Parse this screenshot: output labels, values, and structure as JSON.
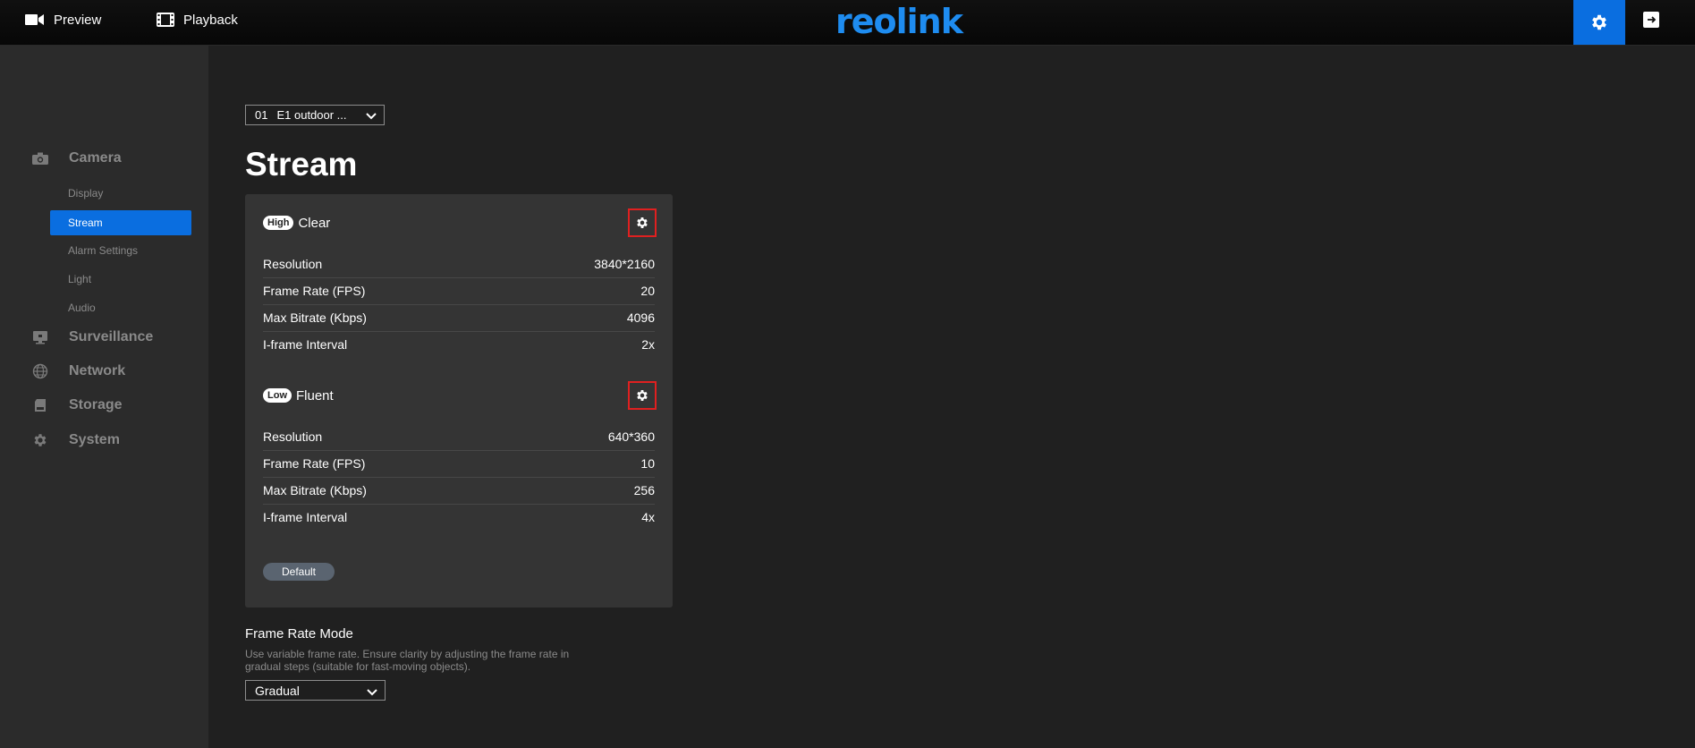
{
  "topbar": {
    "preview_label": "Preview",
    "playback_label": "Playback",
    "logo_text": "reolink",
    "brand_color": "#1e8cf0",
    "accent_color": "#0a6ee0"
  },
  "channel": {
    "number": "01",
    "name": "E1 outdoor ..."
  },
  "page_title": "Stream",
  "sidebar": {
    "groups": [
      {
        "label": "Camera",
        "icon": "camera-icon"
      },
      {
        "label": "Surveillance",
        "icon": "monitor-icon"
      },
      {
        "label": "Network",
        "icon": "globe-icon"
      },
      {
        "label": "Storage",
        "icon": "sd-card-icon"
      },
      {
        "label": "System",
        "icon": "gear-icon"
      }
    ],
    "camera_items": [
      {
        "label": "Display"
      },
      {
        "label": "Stream",
        "active": true
      },
      {
        "label": "Alarm Settings"
      },
      {
        "label": "Light"
      },
      {
        "label": "Audio"
      }
    ]
  },
  "streams": [
    {
      "badge": "High",
      "name": "Clear",
      "rows": [
        {
          "label": "Resolution",
          "value": "3840*2160"
        },
        {
          "label": "Frame Rate (FPS)",
          "value": "20"
        },
        {
          "label": "Max Bitrate (Kbps)",
          "value": "4096"
        },
        {
          "label": "I-frame Interval",
          "value": "2x"
        }
      ]
    },
    {
      "badge": "Low",
      "name": "Fluent",
      "rows": [
        {
          "label": "Resolution",
          "value": "640*360"
        },
        {
          "label": "Frame Rate (FPS)",
          "value": "10"
        },
        {
          "label": "Max Bitrate (Kbps)",
          "value": "256"
        },
        {
          "label": "I-frame Interval",
          "value": "4x"
        }
      ]
    }
  ],
  "default_button": "Default",
  "frame_rate_mode": {
    "label": "Frame Rate Mode",
    "description": "Use variable frame rate. Ensure clarity by adjusting the frame rate in gradual steps (suitable for fast-moving objects).",
    "value": "Gradual"
  }
}
